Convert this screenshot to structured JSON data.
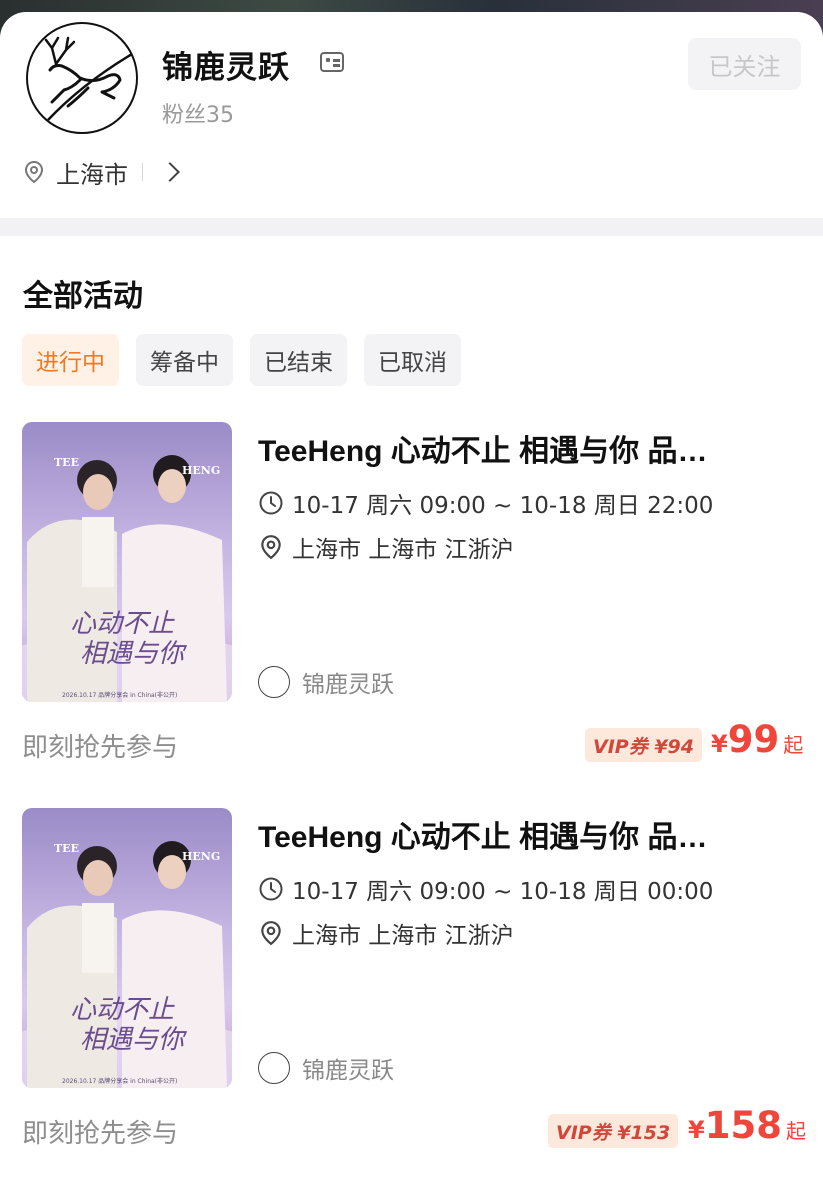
{
  "shop": {
    "name": "锦鹿灵跃",
    "fans": "粉丝35",
    "follow_label": "已关注",
    "location": "上海市"
  },
  "section": {
    "title": "全部活动",
    "tabs": [
      {
        "label": "进行中",
        "active": true
      },
      {
        "label": "筹备中",
        "active": false
      },
      {
        "label": "已结束",
        "active": false
      },
      {
        "label": "已取消",
        "active": false
      }
    ]
  },
  "events": [
    {
      "title": "TeeHeng 心动不止 相遇与你 品…",
      "time": "10-17 周六 09:00 ~ 10-18 周日 22:00",
      "location": "上海市 上海市 江浙沪",
      "organizer": "锦鹿灵跃",
      "cta": "即刻抢先参与",
      "vip": "VIP券 ¥94",
      "price_symbol": "¥",
      "price": "99",
      "price_suffix": "起",
      "poster": {
        "left_name": "TEE",
        "right_name": "HENG",
        "slogan1": "心动不止",
        "slogan2": "相遇与你",
        "footer": "2026.10.17 品牌分享会 in China(非公开)"
      }
    },
    {
      "title": "TeeHeng 心动不止 相遇与你 品…",
      "time": "10-17 周六 09:00 ~ 10-18 周日 00:00",
      "location": "上海市 上海市 江浙沪",
      "organizer": "锦鹿灵跃",
      "cta": "即刻抢先参与",
      "vip": "VIP券 ¥153",
      "price_symbol": "¥",
      "price": "158",
      "price_suffix": "起",
      "poster": {
        "left_name": "TEE",
        "right_name": "HENG",
        "slogan1": "心动不止",
        "slogan2": "相遇与你",
        "footer": "2026.10.17 品牌分享会 in China(非公开)"
      }
    }
  ],
  "colors": {
    "accent_orange": "#f07a22",
    "price_red": "#f0453a",
    "vip_bg": "#fde8dc"
  }
}
